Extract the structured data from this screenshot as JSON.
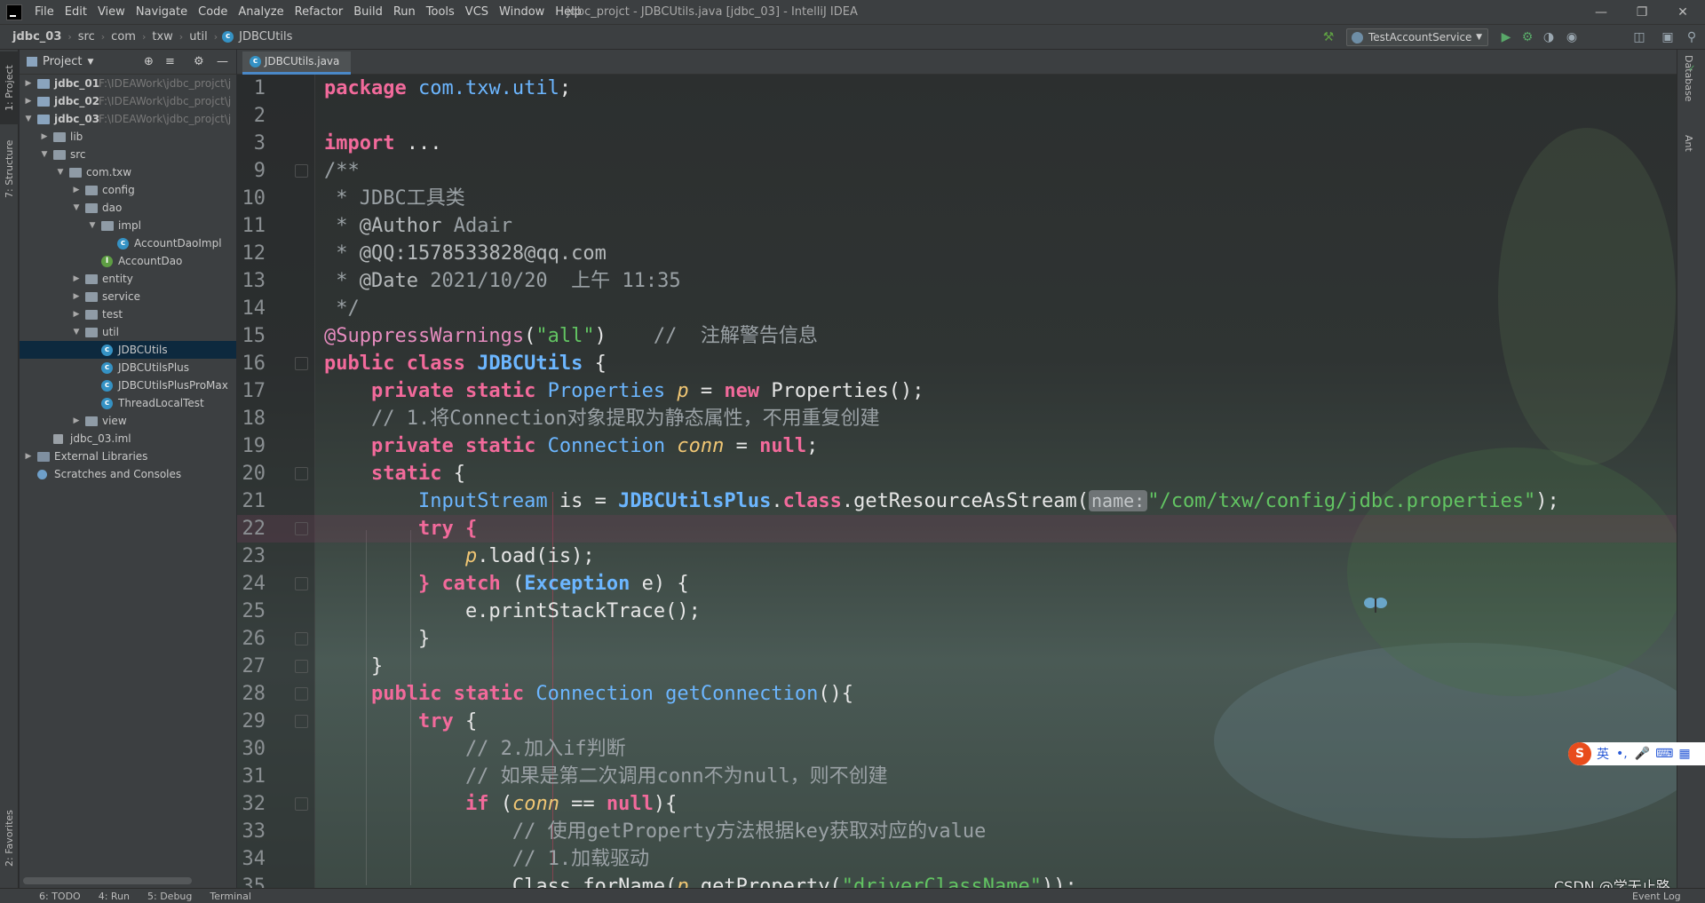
{
  "window": {
    "title": "jdbc_projct - JDBCUtils.java [jdbc_03] - IntelliJ IDEA",
    "menu": [
      "File",
      "Edit",
      "View",
      "Navigate",
      "Code",
      "Analyze",
      "Refactor",
      "Build",
      "Run",
      "Tools",
      "VCS",
      "Window",
      "Help"
    ]
  },
  "breadcrumbs": [
    "jdbc_03",
    "src",
    "com",
    "txw",
    "util",
    "JDBCUtils"
  ],
  "toolbar": {
    "run_config": "TestAccountService"
  },
  "left_tabs": [
    "1: Project",
    "7: Structure",
    "2: Favorites"
  ],
  "right_tabs": [
    "Database",
    "Ant"
  ],
  "project": {
    "header": "Project",
    "tree": [
      {
        "label": "jdbc_01",
        "path": "F:\\IDEAWork\\jdbc_projct\\j",
        "depth": 0,
        "expanded": false,
        "icon": "module",
        "bold": true
      },
      {
        "label": "jdbc_02",
        "path": "F:\\IDEAWork\\jdbc_projct\\j",
        "depth": 0,
        "expanded": false,
        "icon": "module",
        "bold": true
      },
      {
        "label": "jdbc_03",
        "path": "F:\\IDEAWork\\jdbc_projct\\j",
        "depth": 0,
        "expanded": true,
        "icon": "module",
        "bold": true
      },
      {
        "label": "lib",
        "depth": 1,
        "expanded": false,
        "icon": "folder"
      },
      {
        "label": "src",
        "depth": 1,
        "expanded": true,
        "icon": "folder"
      },
      {
        "label": "com.txw",
        "depth": 2,
        "expanded": true,
        "icon": "folder"
      },
      {
        "label": "config",
        "depth": 3,
        "expanded": false,
        "icon": "folder"
      },
      {
        "label": "dao",
        "depth": 3,
        "expanded": true,
        "icon": "folder"
      },
      {
        "label": "impl",
        "depth": 4,
        "expanded": true,
        "icon": "folder"
      },
      {
        "label": "AccountDaoImpl",
        "depth": 5,
        "icon": "class"
      },
      {
        "label": "AccountDao",
        "depth": 4,
        "icon": "interface"
      },
      {
        "label": "entity",
        "depth": 3,
        "expanded": false,
        "icon": "folder"
      },
      {
        "label": "service",
        "depth": 3,
        "expanded": false,
        "icon": "folder"
      },
      {
        "label": "test",
        "depth": 3,
        "expanded": false,
        "icon": "folder"
      },
      {
        "label": "util",
        "depth": 3,
        "expanded": true,
        "icon": "folder"
      },
      {
        "label": "JDBCUtils",
        "depth": 4,
        "icon": "class",
        "selected": true
      },
      {
        "label": "JDBCUtilsPlus",
        "depth": 4,
        "icon": "class"
      },
      {
        "label": "JDBCUtilsPlusProMax",
        "depth": 4,
        "icon": "class"
      },
      {
        "label": "ThreadLocalTest",
        "depth": 4,
        "icon": "class"
      },
      {
        "label": "view",
        "depth": 3,
        "expanded": false,
        "icon": "folder"
      },
      {
        "label": "jdbc_03.iml",
        "depth": 1,
        "icon": "file"
      },
      {
        "label": "External Libraries",
        "depth": 0,
        "expanded": false,
        "icon": "lib"
      },
      {
        "label": "Scratches and Consoles",
        "depth": 0,
        "icon": "scratch"
      }
    ]
  },
  "editor": {
    "tab": "JDBCUtils.java",
    "lines": [
      {
        "n": "1",
        "t": [
          [
            "kw",
            "package"
          ],
          [
            "pn",
            " "
          ],
          [
            "ty",
            "com.txw.util"
          ],
          [
            "pn",
            ";"
          ]
        ]
      },
      {
        "n": "2",
        "t": []
      },
      {
        "n": "3",
        "t": [
          [
            "kw",
            "import"
          ],
          [
            "pn",
            " ..."
          ]
        ]
      },
      {
        "n": "9",
        "t": [
          [
            "cm",
            "/**"
          ]
        ]
      },
      {
        "n": "10",
        "t": [
          [
            "cm",
            " * JDBC工具类"
          ]
        ]
      },
      {
        "n": "11",
        "t": [
          [
            "cm",
            " * "
          ],
          [
            "docfield",
            "@Author"
          ],
          [
            "cm",
            " Adair"
          ]
        ]
      },
      {
        "n": "12",
        "t": [
          [
            "cm",
            " * "
          ],
          [
            "docfield",
            "@QQ:1578533828@qq.com"
          ]
        ]
      },
      {
        "n": "13",
        "t": [
          [
            "cm",
            " * "
          ],
          [
            "docfield",
            "@Date"
          ],
          [
            "cm",
            " 2021/10/20  上午 11:35"
          ]
        ]
      },
      {
        "n": "14",
        "t": [
          [
            "cm",
            " */"
          ]
        ]
      },
      {
        "n": "15",
        "t": [
          [
            "an",
            "@SuppressWarnings"
          ],
          [
            "pn",
            "("
          ],
          [
            "st",
            "\"all\""
          ],
          [
            "pn",
            ")    "
          ],
          [
            "cm",
            "//  注解警告信息"
          ]
        ]
      },
      {
        "n": "16",
        "t": [
          [
            "kw",
            "public class "
          ],
          [
            "tyb",
            "JDBCUtils"
          ],
          [
            "pn",
            " {"
          ]
        ]
      },
      {
        "n": "17",
        "t": [
          [
            "pn",
            "    "
          ],
          [
            "kw",
            "private static "
          ],
          [
            "ty",
            "Properties "
          ],
          [
            "fi",
            "p"
          ],
          [
            "pn",
            " = "
          ],
          [
            "kw",
            "new "
          ],
          [
            "pn",
            "Properties();"
          ]
        ]
      },
      {
        "n": "18",
        "t": [
          [
            "cm",
            "    // 1.将Connection对象提取为静态属性，不用重复创建"
          ]
        ]
      },
      {
        "n": "19",
        "t": [
          [
            "pn",
            "    "
          ],
          [
            "kw",
            "private static "
          ],
          [
            "ty",
            "Connection "
          ],
          [
            "fi",
            "conn"
          ],
          [
            "pn",
            " = "
          ],
          [
            "kw",
            "null"
          ],
          [
            "pn",
            ";"
          ]
        ]
      },
      {
        "n": "20",
        "t": [
          [
            "pn",
            "    "
          ],
          [
            "kw",
            "static"
          ],
          [
            "pn",
            " {"
          ]
        ]
      },
      {
        "n": "21",
        "t": [
          [
            "pn",
            "        "
          ],
          [
            "ty",
            "InputStream "
          ],
          [
            "pn",
            "is = "
          ],
          [
            "tyb",
            "JDBCUtilsPlus"
          ],
          [
            "pn",
            "."
          ],
          [
            "kw",
            "class"
          ],
          [
            "pn",
            ".getResourceAsStream("
          ],
          [
            "hint",
            "name:"
          ],
          [
            "st",
            "\"/com/txw/config/jdbc.properties\""
          ],
          [
            "pn",
            ");"
          ]
        ]
      },
      {
        "n": "22",
        "t": [
          [
            "pn",
            "        "
          ],
          [
            "kw",
            "try"
          ],
          [
            "pn",
            " "
          ],
          [
            "kw",
            "{"
          ]
        ]
      },
      {
        "n": "23",
        "t": [
          [
            "pn",
            "            "
          ],
          [
            "fi",
            "p"
          ],
          [
            "pn",
            ".load(is);"
          ]
        ]
      },
      {
        "n": "24",
        "t": [
          [
            "pn",
            "        "
          ],
          [
            "kw",
            "}"
          ],
          [
            "pn",
            " "
          ],
          [
            "kw",
            "catch"
          ],
          [
            "pn",
            " ("
          ],
          [
            "tyb",
            "Exception"
          ],
          [
            "pn",
            " e) {"
          ]
        ]
      },
      {
        "n": "25",
        "t": [
          [
            "pn",
            "            e.printStackTrace();"
          ]
        ]
      },
      {
        "n": "26",
        "t": [
          [
            "pn",
            "        }"
          ]
        ]
      },
      {
        "n": "27",
        "t": [
          [
            "pn",
            "    }"
          ]
        ]
      },
      {
        "n": "28",
        "t": [
          [
            "pn",
            "    "
          ],
          [
            "kw",
            "public static "
          ],
          [
            "ty",
            "Connection "
          ],
          [
            "ty",
            "getConnection"
          ],
          [
            "pn",
            "(){"
          ]
        ]
      },
      {
        "n": "29",
        "t": [
          [
            "pn",
            "        "
          ],
          [
            "kw",
            "try"
          ],
          [
            "pn",
            " {"
          ]
        ]
      },
      {
        "n": "30",
        "t": [
          [
            "cm",
            "            // 2.加入if判断"
          ]
        ]
      },
      {
        "n": "31",
        "t": [
          [
            "cm",
            "            // 如果是第二次调用conn不为null，则不创建"
          ]
        ]
      },
      {
        "n": "32",
        "t": [
          [
            "pn",
            "            "
          ],
          [
            "kw",
            "if"
          ],
          [
            "pn",
            " ("
          ],
          [
            "fi",
            "conn"
          ],
          [
            "pn",
            " == "
          ],
          [
            "kw",
            "null"
          ],
          [
            "pn",
            "){"
          ]
        ]
      },
      {
        "n": "33",
        "t": [
          [
            "cm",
            "                // 使用getProperty方法根据key获取对应的value"
          ]
        ]
      },
      {
        "n": "34",
        "t": [
          [
            "cm",
            "                // 1.加载驱动"
          ]
        ]
      },
      {
        "n": "35",
        "t": [
          [
            "pn",
            "                Class.forName("
          ],
          [
            "fi",
            "p"
          ],
          [
            "pn",
            ".getProperty("
          ],
          [
            "st",
            "\"driverClassName\""
          ],
          [
            "pn",
            "));"
          ]
        ]
      }
    ],
    "current_line": "22"
  },
  "status_tools": [
    "6: TODO",
    "4: Run",
    "5: Debug",
    "Terminal"
  ],
  "event_log": "Event Log",
  "watermark": "CSDN @学无止路",
  "ime": {
    "mode": "英"
  },
  "colors": {
    "keyword": "#f26a9b",
    "type": "#6cb6ff",
    "string": "#62c462",
    "comment": "#9aa1a5",
    "selection": "#0d293e",
    "accent": "#4a88c7"
  }
}
